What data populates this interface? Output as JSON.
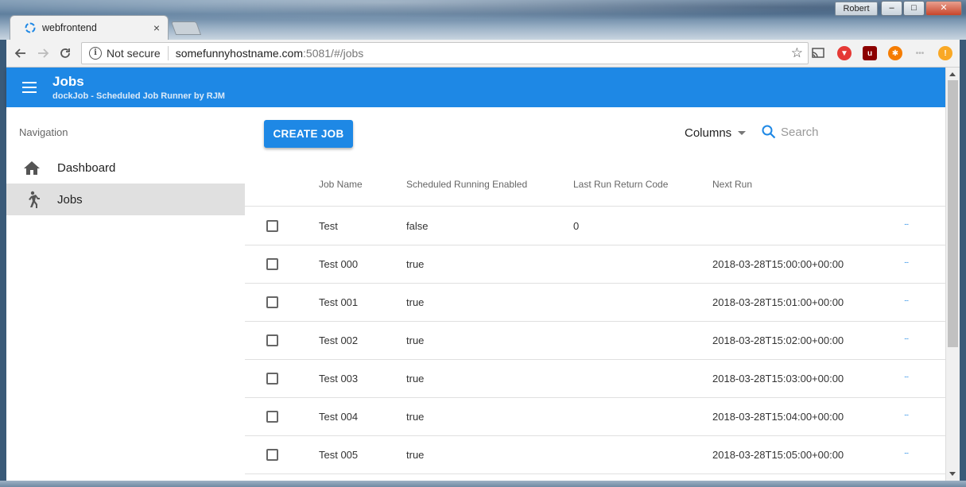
{
  "browser": {
    "tab_title": "webfrontend",
    "tab_close": "×",
    "profile_name": "Robert",
    "window_buttons": {
      "minimize": "–",
      "maximize": "□",
      "close": "✕"
    },
    "security_label": "Not secure",
    "url_host": "somefunnyhostname.com",
    "url_path": ":5081/#/jobs"
  },
  "appbar": {
    "title": "Jobs",
    "subtitle": "dockJob - Scheduled Job Runner by RJM",
    "color": "#1e88e5"
  },
  "sidebar": {
    "header": "Navigation",
    "items": [
      {
        "label": "Dashboard",
        "icon": "home-icon",
        "active": false
      },
      {
        "label": "Jobs",
        "icon": "runner-icon",
        "active": true
      }
    ]
  },
  "toolbar": {
    "create_label": "CREATE JOB",
    "columns_label": "Columns",
    "search_placeholder": "Search"
  },
  "table": {
    "headers": [
      "Job Name",
      "Scheduled Running Enabled",
      "Last Run Return Code",
      "Next Run"
    ],
    "rows": [
      {
        "name": "Test",
        "enabled": "false",
        "return_code": "0",
        "next_run": ""
      },
      {
        "name": "Test 000",
        "enabled": "true",
        "return_code": "",
        "next_run": "2018-03-28T15:00:00+00:00"
      },
      {
        "name": "Test 001",
        "enabled": "true",
        "return_code": "",
        "next_run": "2018-03-28T15:01:00+00:00"
      },
      {
        "name": "Test 002",
        "enabled": "true",
        "return_code": "",
        "next_run": "2018-03-28T15:02:00+00:00"
      },
      {
        "name": "Test 003",
        "enabled": "true",
        "return_code": "",
        "next_run": "2018-03-28T15:03:00+00:00"
      },
      {
        "name": "Test 004",
        "enabled": "true",
        "return_code": "",
        "next_run": "2018-03-28T15:04:00+00:00"
      },
      {
        "name": "Test 005",
        "enabled": "true",
        "return_code": "",
        "next_run": "2018-03-28T15:05:00+00:00"
      }
    ],
    "row_action": "..."
  }
}
